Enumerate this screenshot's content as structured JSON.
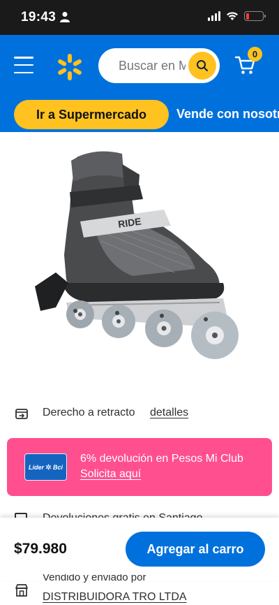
{
  "status_bar": {
    "time": "19:43"
  },
  "header": {
    "search_placeholder": "Buscar en M",
    "cart_count": "0",
    "brand_color": "#0071dc",
    "accent_color": "#ffc220"
  },
  "subnav": {
    "supermarket_label": "Ir a Supermercado",
    "sell_label": "Vende con nosotr"
  },
  "product": {
    "image_description_icon": "inline-skate-image",
    "return_policy_text": "Derecho a retracto",
    "return_policy_link": "detalles",
    "price": "$79.980",
    "add_to_cart_label": "Agregar al carro"
  },
  "promo": {
    "card_left": "Lider",
    "card_right": "Bci",
    "title": "6% devolución en Pesos Mi Club",
    "link": "Solicita aquí",
    "color": "#ff4f8f"
  },
  "partial_row": {
    "text": "Devoluciones gratis en Santiago"
  },
  "seller": {
    "label": "Vendido y enviado por",
    "name": "DISTRIBUIDORA TRO LTDA"
  }
}
